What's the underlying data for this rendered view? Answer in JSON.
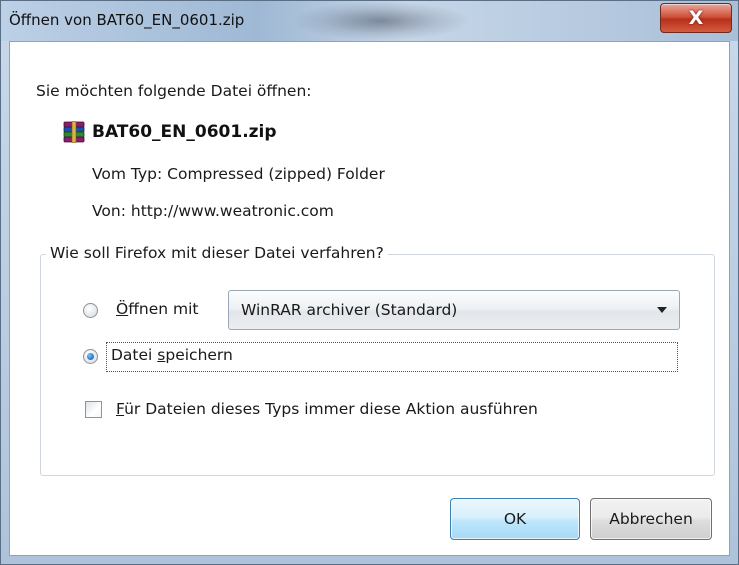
{
  "window": {
    "title": "Öffnen von BAT60_EN_0601.zip",
    "close_symbol": "X"
  },
  "prompt": "Sie möchten folgende Datei öffnen:",
  "file": {
    "icon": "winrar-archive-icon",
    "name": "BAT60_EN_0601.zip",
    "type_label": "Vom Typ:",
    "type_value": "Compressed (zipped) Folder",
    "source_label": "Von:",
    "source_value": "http://www.weatronic.com"
  },
  "action_group": {
    "legend": "Wie soll Firefox mit dieser Datei verfahren?",
    "open_with": {
      "label_mnemonic": "Ö",
      "label_rest": "ffnen mit",
      "checked": false,
      "selected_app": "WinRAR archiver (Standard)"
    },
    "save_file": {
      "label_pre": "Datei ",
      "label_mnemonic": "s",
      "label_rest": "peichern",
      "checked": true
    },
    "always_do": {
      "label_mnemonic": "F",
      "label_rest": "ür Dateien dieses Typs immer diese Aktion ausführen",
      "checked": false
    }
  },
  "buttons": {
    "ok": "OK",
    "cancel": "Abbrechen"
  },
  "colors": {
    "ok_border": "#3c7fb1",
    "close_button": "#c8452e",
    "radio_dot": "#1f6fc4"
  }
}
